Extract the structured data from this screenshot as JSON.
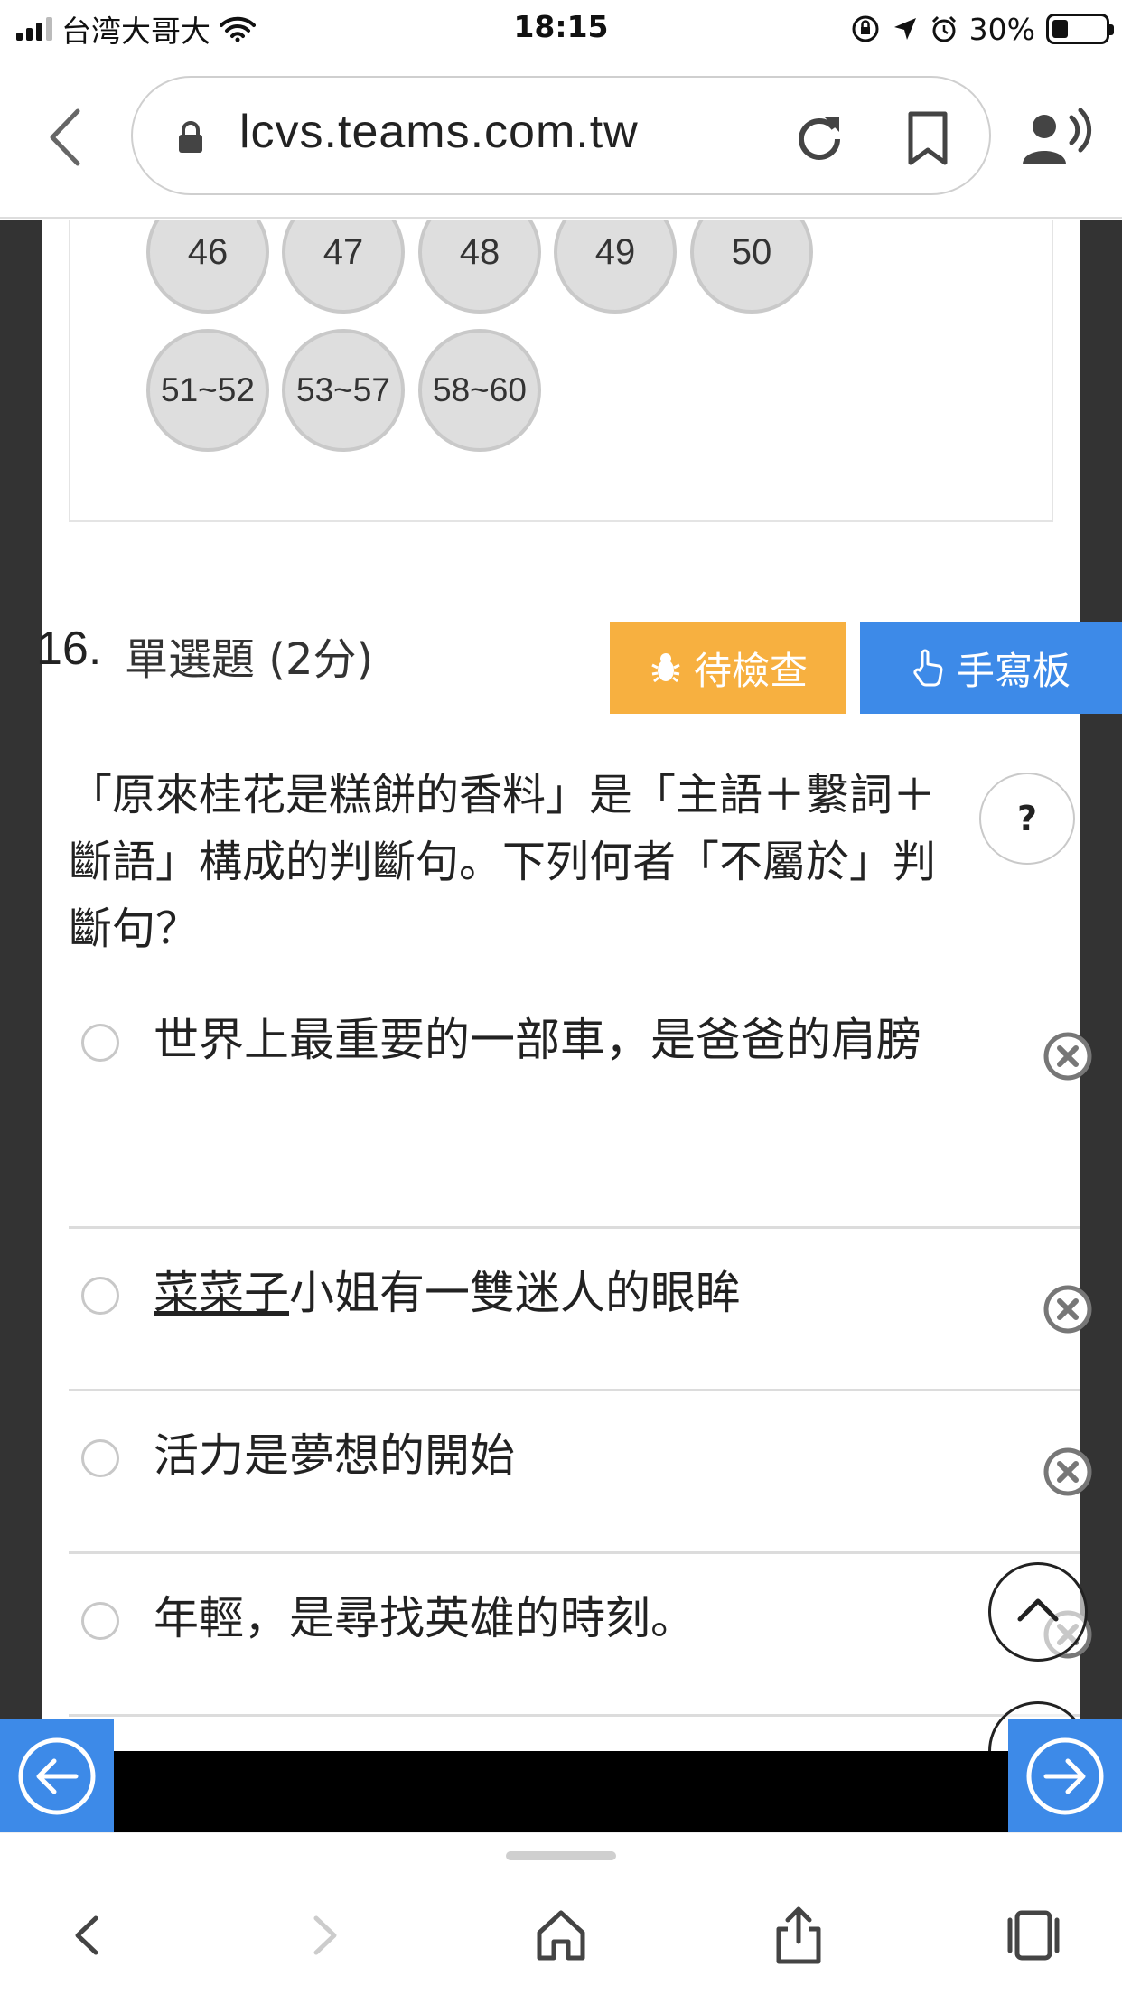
{
  "status_bar": {
    "carrier": "台湾大哥大",
    "time": "18:15",
    "battery": "30%"
  },
  "browser": {
    "url": "lcvs.teams.com.tw"
  },
  "question_nav": {
    "row1": [
      "46",
      "47",
      "48",
      "49",
      "50"
    ],
    "row2": [
      "51~52",
      "53~57",
      "58~60"
    ]
  },
  "question": {
    "number": "16.",
    "type": "單選題 (2分)",
    "pending_label": "待檢查",
    "handwrite_label": "手寫板",
    "help": "?",
    "text": "「原來桂花是糕餅的香料」是「主語＋繫詞＋斷語」構成的判斷句。下列何者「不屬於」判斷句？",
    "options": [
      {
        "text": "世界上最重要的一部車，是爸爸的肩膀"
      },
      {
        "underlined": "菜菜子",
        "text": "小姐有一雙迷人的眼眸"
      },
      {
        "text": "活力是夢想的開始"
      },
      {
        "text": "年輕，是尋找英雄的時刻。"
      }
    ]
  },
  "colors": {
    "pending": "#f7b040",
    "primary": "#3d8ae8",
    "side": "#333333"
  }
}
